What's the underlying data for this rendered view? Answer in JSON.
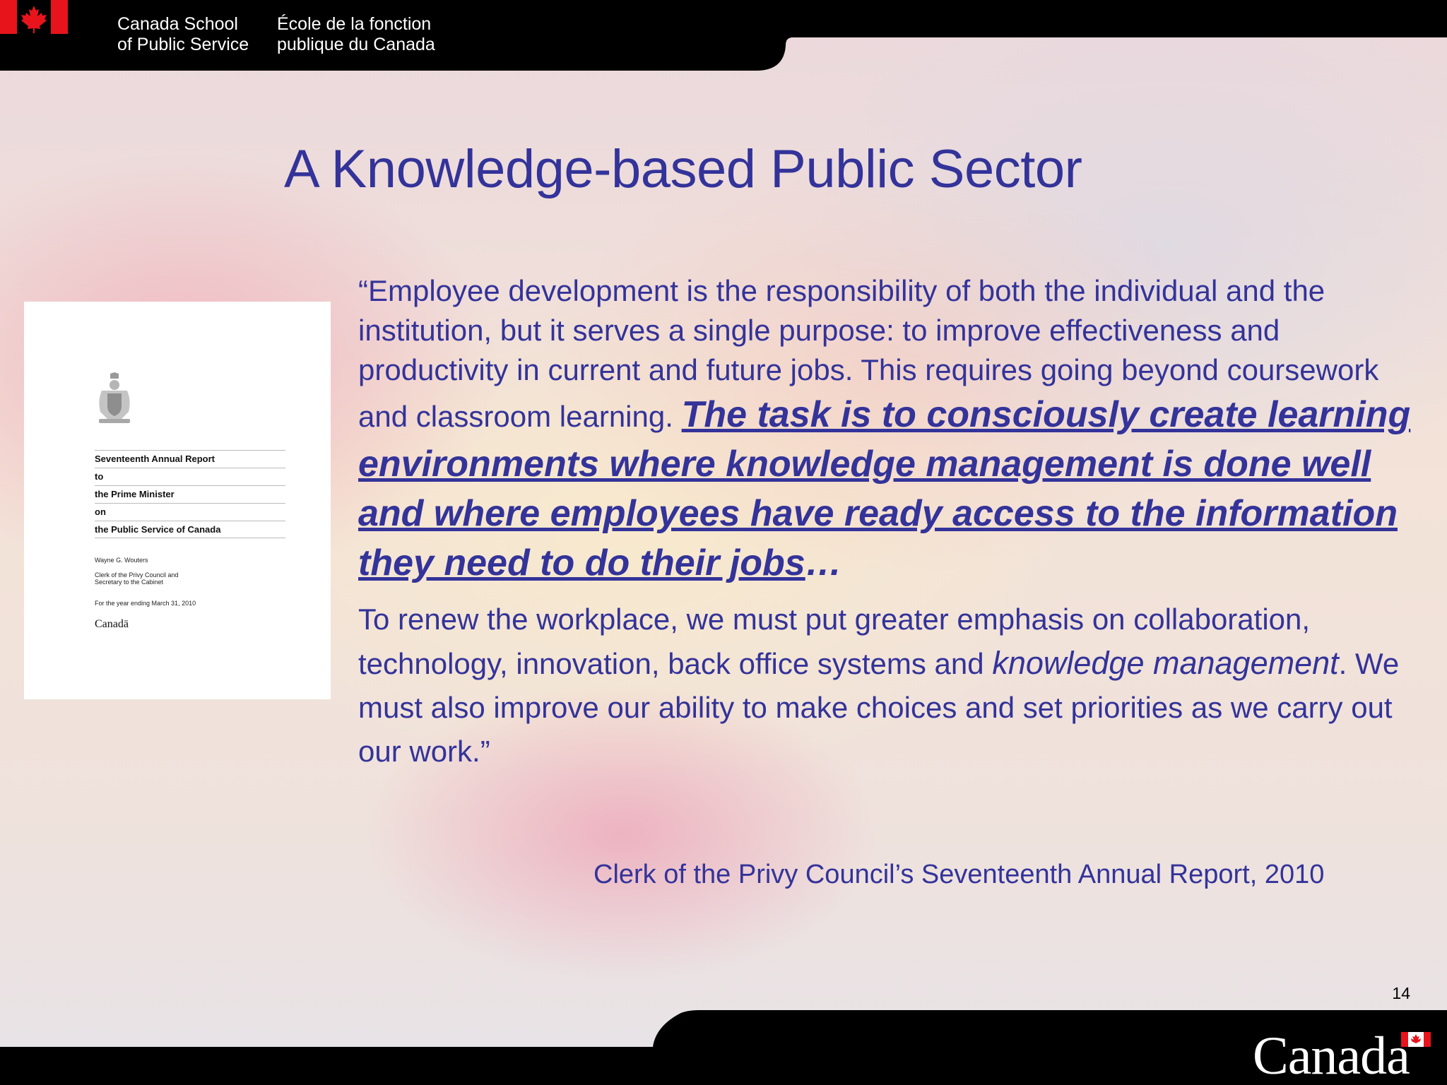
{
  "header": {
    "org_en_line1": "Canada School",
    "org_en_line2": "of Public Service",
    "org_fr_line1": "École de la fonction",
    "org_fr_line2": "publique du Canada",
    "flag_icon": "canada-flag-icon"
  },
  "slide": {
    "title": "A Knowledge-based Public Sector",
    "quote_part1": "“Employee development is the responsibility of both the individual and the institution, but it serves a single purpose: to improve effectiveness and productivity in current and future jobs. This requires going beyond coursework and classroom learning. ",
    "quote_emph_a": "The task is to consciously create learning environments where knowledge management is done well",
    "quote_emph_b": " and where employees have ready access to the information they need to do their jobs",
    "quote_ellipsis": "…",
    "para2_start": "To renew the workplace, we must put greater emphasis on collaboration, technology, innovation, back office systems and ",
    "para2_ital": "knowledge management",
    "para2_end": ". We must also improve our ability to make choices and set priorities as we carry out our work.”",
    "attribution": "Clerk of the Privy Council’s Seventeenth Annual Report, 2010",
    "page_number": "14"
  },
  "report_cover": {
    "line1": "Seventeenth Annual Report",
    "line2": "to",
    "line3": "the Prime Minister",
    "line4": "on",
    "line5": "the Public Service of Canada",
    "author": "Wayne G. Wouters",
    "role_line1": "Clerk of the Privy Council and",
    "role_line2": "Secretary to the Cabinet",
    "period": "For the year ending March 31, 2010",
    "logo": "Canadä",
    "crest_icon": "coat-of-arms-icon"
  },
  "footer": {
    "wordmark": "Canada",
    "flag_icon": "canada-wordmark-flag-icon"
  },
  "colors": {
    "title_blue": "#33339a",
    "bar_black": "#000000",
    "flag_red": "#e8141c"
  }
}
